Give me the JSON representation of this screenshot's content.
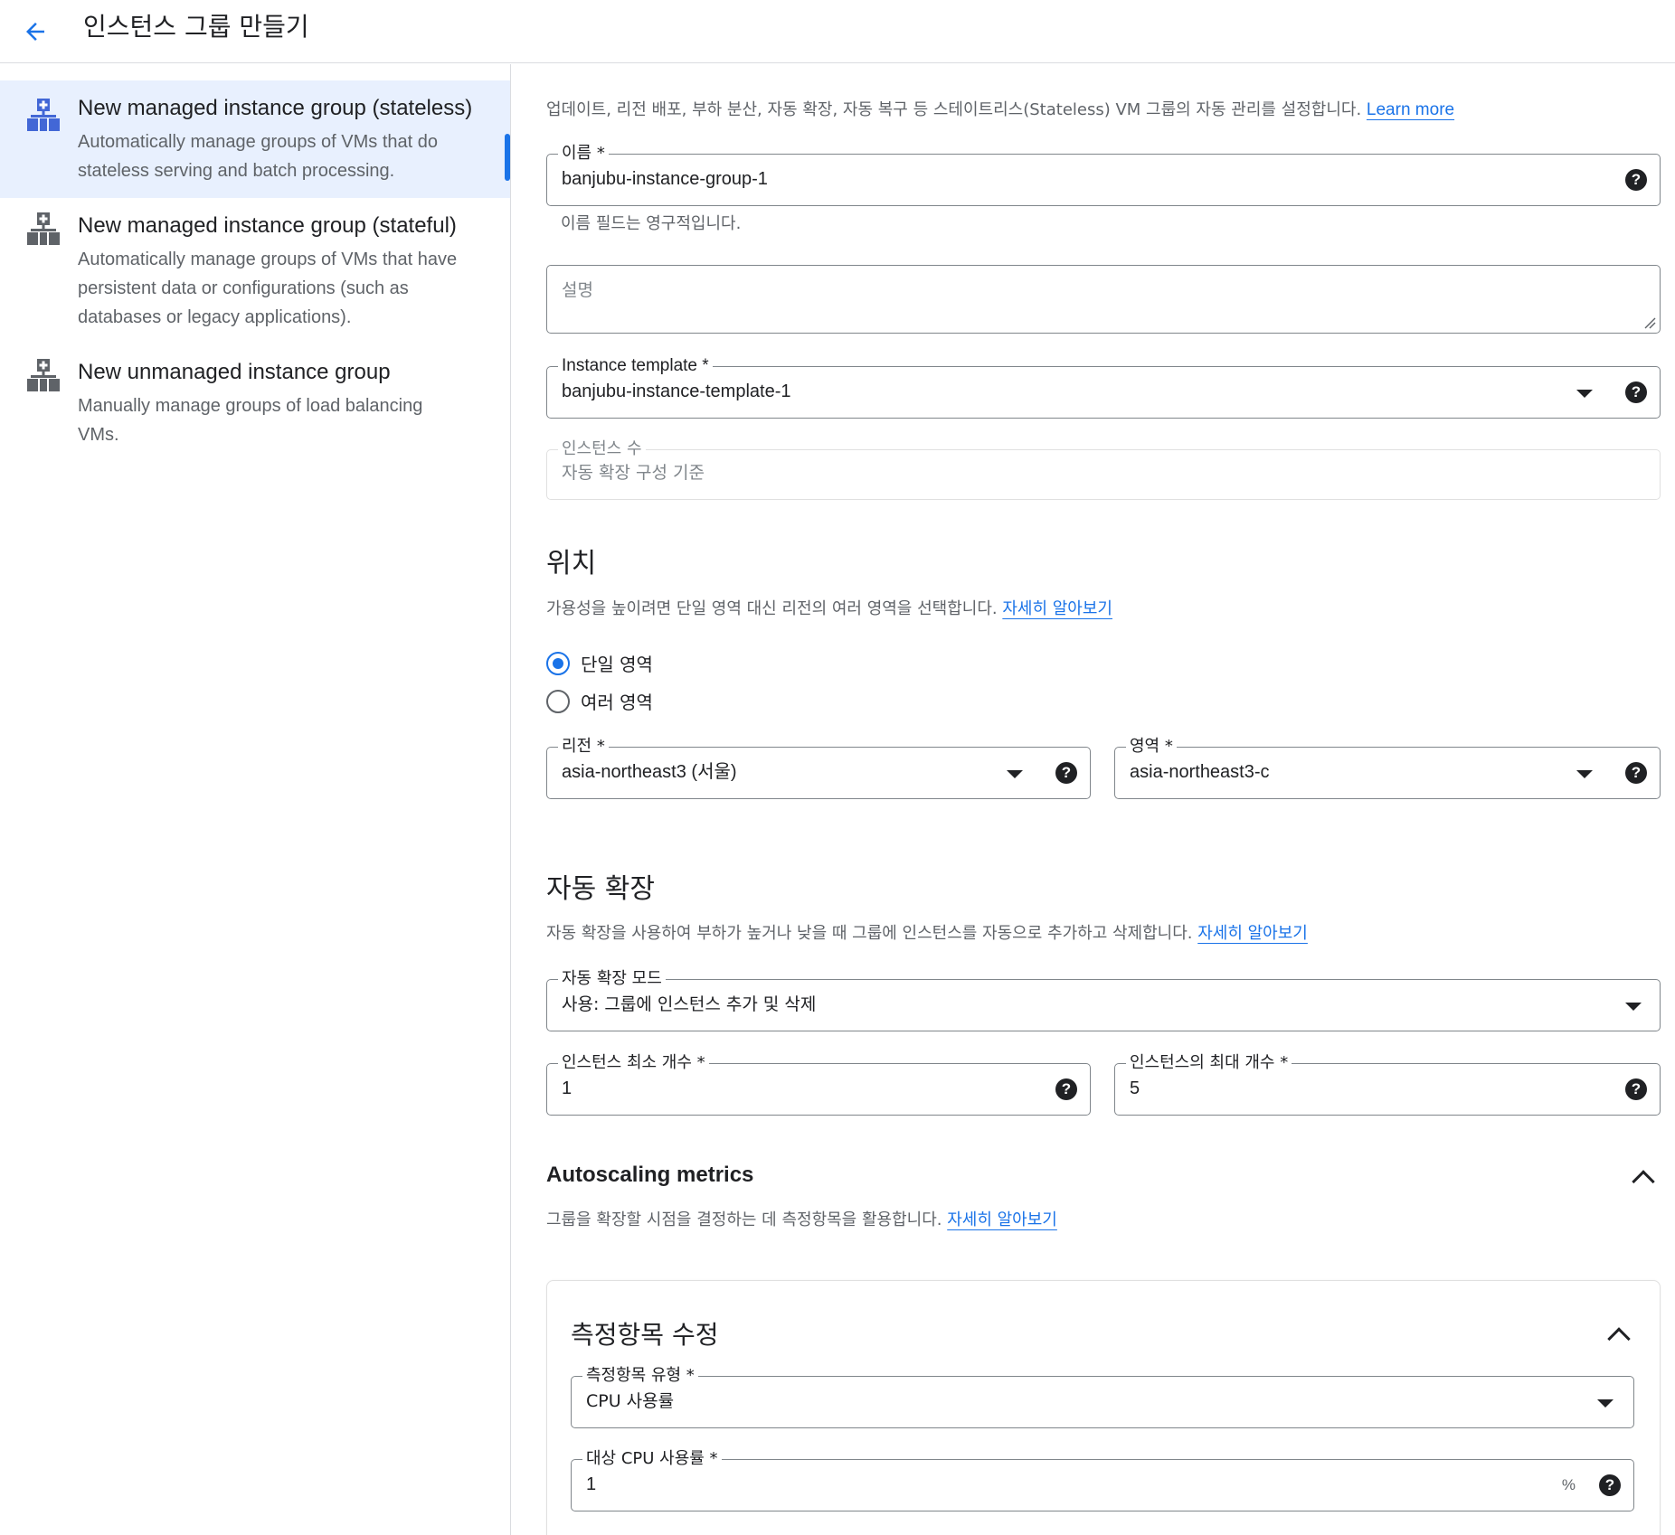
{
  "header": {
    "title": "인스턴스 그룹 만들기"
  },
  "sidebar": {
    "items": [
      {
        "title": "New managed instance group (stateless)",
        "desc_lines": [
          "Automatically manage groups of VMs that do",
          "stateless serving and batch processing."
        ]
      },
      {
        "title": "New managed instance group (stateful)",
        "desc_lines": [
          "Automatically manage groups of VMs that have",
          "persistent data or configurations (such as",
          "databases or legacy applications)."
        ]
      },
      {
        "title": "New unmanaged instance group",
        "desc_lines": [
          "Manually manage groups of load balancing",
          "VMs."
        ]
      }
    ]
  },
  "intro": {
    "text": "업데이트, 리전 배포, 부하 분산, 자동 확장, 자동 복구 등 스테이트리스(Stateless) VM 그룹의 자동 관리를 설정합니다. ",
    "link": "Learn more"
  },
  "form": {
    "name": {
      "label": "이름 *",
      "value": "banjubu-instance-group-1",
      "hint": "이름 필드는 영구적입니다."
    },
    "description": {
      "placeholder": "설명"
    },
    "template": {
      "label": "Instance template *",
      "value": "banjubu-instance-template-1"
    },
    "instance_count": {
      "label": "인스턴스 수",
      "placeholder": "자동 확장 구성 기준"
    }
  },
  "location": {
    "title": "위치",
    "desc": "가용성을 높이려면 단일 영역 대신 리전의 여러 영역을 선택합니다. ",
    "link": "자세히 알아보기",
    "options": [
      "단일 영역",
      "여러 영역"
    ],
    "selected_index": 0,
    "region": {
      "label": "리전 *",
      "value": "asia-northeast3 (서울)"
    },
    "zone": {
      "label": "영역 *",
      "value": "asia-northeast3-c"
    }
  },
  "autoscaling": {
    "title": "자동 확장",
    "desc": "자동 확장을 사용하여 부하가 높거나 낮을 때 그룹에 인스턴스를 자동으로 추가하고 삭제합니다. ",
    "link": "자세히 알아보기",
    "mode": {
      "label": "자동 확장 모드",
      "value": "사용: 그룹에 인스턴스 추가 및 삭제"
    },
    "min": {
      "label": "인스턴스 최소 개수 *",
      "value": "1"
    },
    "max": {
      "label": "인스턴스의 최대 개수 *",
      "value": "5"
    }
  },
  "metrics": {
    "title": "Autoscaling metrics",
    "desc": "그룹을 확장할 시점을 결정하는 데 측정항목을 활용합니다. ",
    "link": "자세히 알아보기",
    "card": {
      "title": "측정항목 수정",
      "type": {
        "label": "측정항목 유형 *",
        "value": "CPU 사용률"
      },
      "target": {
        "label": "대상 CPU 사용률 *",
        "value": "1",
        "unit": "%"
      }
    }
  },
  "icons": {
    "help_glyph": "?"
  },
  "colors": {
    "accent": "#1a73e8",
    "active_bg": "#e8f0fe",
    "icon_active": "#4267d6",
    "icon_inactive": "#5f6368"
  }
}
